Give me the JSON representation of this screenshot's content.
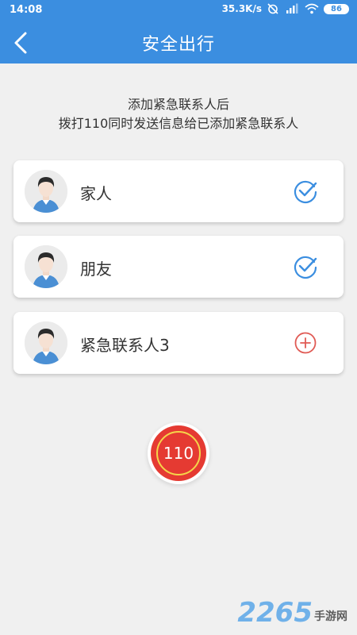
{
  "status_bar": {
    "time": "14:08",
    "speed": "35.3K/s",
    "battery": "86"
  },
  "header": {
    "title": "安全出行"
  },
  "intro": {
    "line1": "添加紧急联系人后",
    "line2": "拨打110同时发送信息给已添加紧急联系人"
  },
  "contacts": [
    {
      "name": "家人",
      "status": "added",
      "icon": "check-circle-icon"
    },
    {
      "name": "朋友",
      "status": "added",
      "icon": "check-circle-icon"
    },
    {
      "name": "紧急联系人3",
      "status": "empty",
      "icon": "plus-circle-icon"
    }
  ],
  "sos_button": {
    "label": "110"
  },
  "watermark": {
    "number": "2265",
    "text": "手游网"
  },
  "colors": {
    "header": "#3b8ee0",
    "check": "#3b8ee0",
    "add": "#e05a54",
    "sos": "#e53a32",
    "sos_ring": "#f5d44a"
  }
}
